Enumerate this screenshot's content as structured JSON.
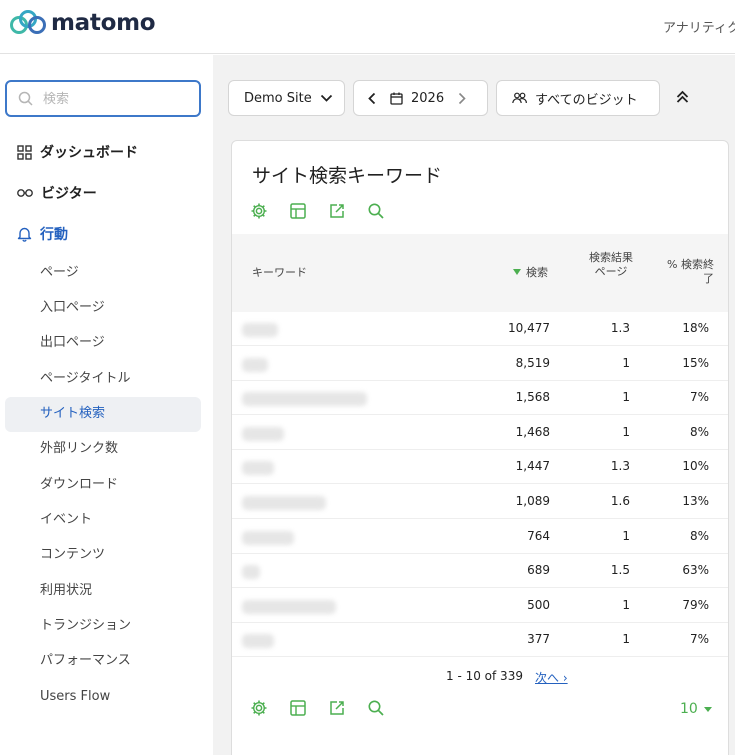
{
  "header": {
    "logo_text": "matomo",
    "nav_text": "アナリティク"
  },
  "sidebar": {
    "search_placeholder": "検索",
    "categories": [
      {
        "label": "ダッシュボード",
        "icon": "dashboard-grid-icon"
      },
      {
        "label": "ビジター",
        "icon": "glasses-icon"
      },
      {
        "label": "行動",
        "icon": "bell-icon"
      }
    ],
    "subitems": [
      {
        "label": "ページ"
      },
      {
        "label": "入口ページ"
      },
      {
        "label": "出口ページ"
      },
      {
        "label": "ページタイトル"
      },
      {
        "label": "サイト検索"
      },
      {
        "label": "外部リンク数"
      },
      {
        "label": "ダウンロード"
      },
      {
        "label": "イベント"
      },
      {
        "label": "コンテンツ"
      },
      {
        "label": "利用状況"
      },
      {
        "label": "トランジション"
      },
      {
        "label": "パフォーマンス"
      },
      {
        "label": "Users Flow"
      }
    ],
    "active_subitem": "サイト検索"
  },
  "controls": {
    "site_label": "Demo Site",
    "date_label": "2026",
    "segment_label": "すべてのビジット"
  },
  "report": {
    "title": "サイト検索キーワード",
    "columns": {
      "keyword": "キーワード",
      "searches": "検索",
      "pages_per_search": "検索結果ページ",
      "exit_rate": "% 検索終了"
    },
    "rows": [
      {
        "searches": "10,477",
        "pages": "1.3",
        "exit": "18%"
      },
      {
        "searches": "8,519",
        "pages": "1",
        "exit": "15%"
      },
      {
        "searches": "1,568",
        "pages": "1",
        "exit": "7%"
      },
      {
        "searches": "1,468",
        "pages": "1",
        "exit": "8%"
      },
      {
        "searches": "1,447",
        "pages": "1.3",
        "exit": "10%"
      },
      {
        "searches": "1,089",
        "pages": "1.6",
        "exit": "13%"
      },
      {
        "searches": "764",
        "pages": "1",
        "exit": "8%"
      },
      {
        "searches": "689",
        "pages": "1.5",
        "exit": "63%"
      },
      {
        "searches": "500",
        "pages": "1",
        "exit": "79%"
      },
      {
        "searches": "377",
        "pages": "1",
        "exit": "7%"
      }
    ],
    "pagination": {
      "range": "1 - 10 of 339",
      "next": "次へ ›"
    },
    "limit": "10"
  },
  "colors": {
    "accent_blue": "#2461bf",
    "accent_green": "#4caf50",
    "logo_teal": "#3fb8a8"
  }
}
